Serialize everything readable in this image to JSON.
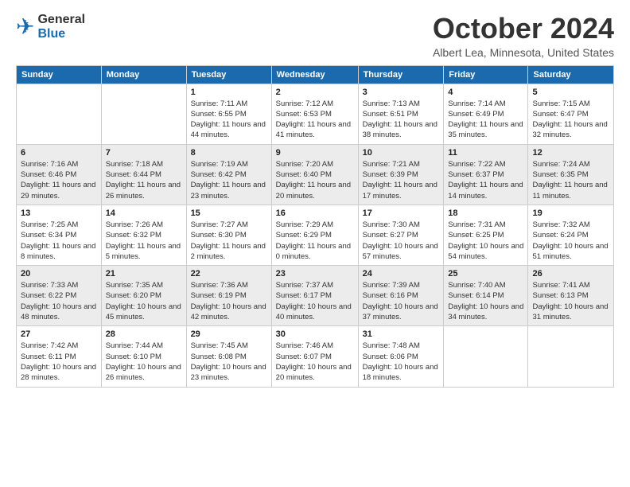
{
  "header": {
    "logo_general": "General",
    "logo_blue": "Blue",
    "title": "October 2024",
    "location": "Albert Lea, Minnesota, United States"
  },
  "weekdays": [
    "Sunday",
    "Monday",
    "Tuesday",
    "Wednesday",
    "Thursday",
    "Friday",
    "Saturday"
  ],
  "weeks": [
    [
      {
        "day": "",
        "sunrise": "",
        "sunset": "",
        "daylight": ""
      },
      {
        "day": "",
        "sunrise": "",
        "sunset": "",
        "daylight": ""
      },
      {
        "day": "1",
        "sunrise": "Sunrise: 7:11 AM",
        "sunset": "Sunset: 6:55 PM",
        "daylight": "Daylight: 11 hours and 44 minutes."
      },
      {
        "day": "2",
        "sunrise": "Sunrise: 7:12 AM",
        "sunset": "Sunset: 6:53 PM",
        "daylight": "Daylight: 11 hours and 41 minutes."
      },
      {
        "day": "3",
        "sunrise": "Sunrise: 7:13 AM",
        "sunset": "Sunset: 6:51 PM",
        "daylight": "Daylight: 11 hours and 38 minutes."
      },
      {
        "day": "4",
        "sunrise": "Sunrise: 7:14 AM",
        "sunset": "Sunset: 6:49 PM",
        "daylight": "Daylight: 11 hours and 35 minutes."
      },
      {
        "day": "5",
        "sunrise": "Sunrise: 7:15 AM",
        "sunset": "Sunset: 6:47 PM",
        "daylight": "Daylight: 11 hours and 32 minutes."
      }
    ],
    [
      {
        "day": "6",
        "sunrise": "Sunrise: 7:16 AM",
        "sunset": "Sunset: 6:46 PM",
        "daylight": "Daylight: 11 hours and 29 minutes."
      },
      {
        "day": "7",
        "sunrise": "Sunrise: 7:18 AM",
        "sunset": "Sunset: 6:44 PM",
        "daylight": "Daylight: 11 hours and 26 minutes."
      },
      {
        "day": "8",
        "sunrise": "Sunrise: 7:19 AM",
        "sunset": "Sunset: 6:42 PM",
        "daylight": "Daylight: 11 hours and 23 minutes."
      },
      {
        "day": "9",
        "sunrise": "Sunrise: 7:20 AM",
        "sunset": "Sunset: 6:40 PM",
        "daylight": "Daylight: 11 hours and 20 minutes."
      },
      {
        "day": "10",
        "sunrise": "Sunrise: 7:21 AM",
        "sunset": "Sunset: 6:39 PM",
        "daylight": "Daylight: 11 hours and 17 minutes."
      },
      {
        "day": "11",
        "sunrise": "Sunrise: 7:22 AM",
        "sunset": "Sunset: 6:37 PM",
        "daylight": "Daylight: 11 hours and 14 minutes."
      },
      {
        "day": "12",
        "sunrise": "Sunrise: 7:24 AM",
        "sunset": "Sunset: 6:35 PM",
        "daylight": "Daylight: 11 hours and 11 minutes."
      }
    ],
    [
      {
        "day": "13",
        "sunrise": "Sunrise: 7:25 AM",
        "sunset": "Sunset: 6:34 PM",
        "daylight": "Daylight: 11 hours and 8 minutes."
      },
      {
        "day": "14",
        "sunrise": "Sunrise: 7:26 AM",
        "sunset": "Sunset: 6:32 PM",
        "daylight": "Daylight: 11 hours and 5 minutes."
      },
      {
        "day": "15",
        "sunrise": "Sunrise: 7:27 AM",
        "sunset": "Sunset: 6:30 PM",
        "daylight": "Daylight: 11 hours and 2 minutes."
      },
      {
        "day": "16",
        "sunrise": "Sunrise: 7:29 AM",
        "sunset": "Sunset: 6:29 PM",
        "daylight": "Daylight: 11 hours and 0 minutes."
      },
      {
        "day": "17",
        "sunrise": "Sunrise: 7:30 AM",
        "sunset": "Sunset: 6:27 PM",
        "daylight": "Daylight: 10 hours and 57 minutes."
      },
      {
        "day": "18",
        "sunrise": "Sunrise: 7:31 AM",
        "sunset": "Sunset: 6:25 PM",
        "daylight": "Daylight: 10 hours and 54 minutes."
      },
      {
        "day": "19",
        "sunrise": "Sunrise: 7:32 AM",
        "sunset": "Sunset: 6:24 PM",
        "daylight": "Daylight: 10 hours and 51 minutes."
      }
    ],
    [
      {
        "day": "20",
        "sunrise": "Sunrise: 7:33 AM",
        "sunset": "Sunset: 6:22 PM",
        "daylight": "Daylight: 10 hours and 48 minutes."
      },
      {
        "day": "21",
        "sunrise": "Sunrise: 7:35 AM",
        "sunset": "Sunset: 6:20 PM",
        "daylight": "Daylight: 10 hours and 45 minutes."
      },
      {
        "day": "22",
        "sunrise": "Sunrise: 7:36 AM",
        "sunset": "Sunset: 6:19 PM",
        "daylight": "Daylight: 10 hours and 42 minutes."
      },
      {
        "day": "23",
        "sunrise": "Sunrise: 7:37 AM",
        "sunset": "Sunset: 6:17 PM",
        "daylight": "Daylight: 10 hours and 40 minutes."
      },
      {
        "day": "24",
        "sunrise": "Sunrise: 7:39 AM",
        "sunset": "Sunset: 6:16 PM",
        "daylight": "Daylight: 10 hours and 37 minutes."
      },
      {
        "day": "25",
        "sunrise": "Sunrise: 7:40 AM",
        "sunset": "Sunset: 6:14 PM",
        "daylight": "Daylight: 10 hours and 34 minutes."
      },
      {
        "day": "26",
        "sunrise": "Sunrise: 7:41 AM",
        "sunset": "Sunset: 6:13 PM",
        "daylight": "Daylight: 10 hours and 31 minutes."
      }
    ],
    [
      {
        "day": "27",
        "sunrise": "Sunrise: 7:42 AM",
        "sunset": "Sunset: 6:11 PM",
        "daylight": "Daylight: 10 hours and 28 minutes."
      },
      {
        "day": "28",
        "sunrise": "Sunrise: 7:44 AM",
        "sunset": "Sunset: 6:10 PM",
        "daylight": "Daylight: 10 hours and 26 minutes."
      },
      {
        "day": "29",
        "sunrise": "Sunrise: 7:45 AM",
        "sunset": "Sunset: 6:08 PM",
        "daylight": "Daylight: 10 hours and 23 minutes."
      },
      {
        "day": "30",
        "sunrise": "Sunrise: 7:46 AM",
        "sunset": "Sunset: 6:07 PM",
        "daylight": "Daylight: 10 hours and 20 minutes."
      },
      {
        "day": "31",
        "sunrise": "Sunrise: 7:48 AM",
        "sunset": "Sunset: 6:06 PM",
        "daylight": "Daylight: 10 hours and 18 minutes."
      },
      {
        "day": "",
        "sunrise": "",
        "sunset": "",
        "daylight": ""
      },
      {
        "day": "",
        "sunrise": "",
        "sunset": "",
        "daylight": ""
      }
    ]
  ]
}
